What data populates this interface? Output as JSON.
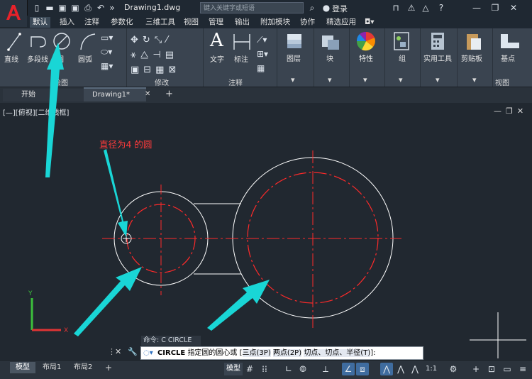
{
  "title": {
    "doc": "Drawing1.dwg",
    "search_placeholder": "键入关键字或短语",
    "login": "登录"
  },
  "ribbon_tabs": [
    "默认",
    "插入",
    "注释",
    "参数化",
    "三维工具",
    "视图",
    "管理",
    "输出",
    "附加模块",
    "协作",
    "精选应用"
  ],
  "ribbon": {
    "draw": {
      "line": "直线",
      "polyline": "多段线",
      "circle": "圆",
      "arc": "圆弧",
      "title": "绘图"
    },
    "modify": {
      "title": "修改"
    },
    "annotate": {
      "text": "文字",
      "dim": "标注",
      "title": "注释"
    },
    "layers": "图层",
    "block": "块",
    "props": "特性",
    "group": "组",
    "utilities": "实用工具",
    "clipboard": "剪贴板",
    "base": "基点",
    "view_title": "视图"
  },
  "doc_tabs": {
    "start": "开始",
    "drawing": "Drawing1*",
    "close": "✕",
    "add": "+"
  },
  "view_label": "[—][俯视][二维线框]",
  "annotation": "直径为4 的圆",
  "command": {
    "history": "命令: C CIRCLE",
    "cmd": "CIRCLE",
    "prompt": "指定圆的圆心或 [",
    "opt1": "三点(3P)",
    "opt2": "两点(2P)",
    "opt3": "切点、切点、半径(T)",
    "end": "]:"
  },
  "layout_tabs": {
    "model": "模型",
    "l1": "布局1",
    "l2": "布局2",
    "add": "+"
  },
  "status": {
    "model": "模型",
    "scale": "1:1"
  },
  "colors": {
    "accent": "#00e5e5",
    "center": "#ff2a2a",
    "geometry": "#ffffff",
    "annotation": "#ff3b3b"
  }
}
